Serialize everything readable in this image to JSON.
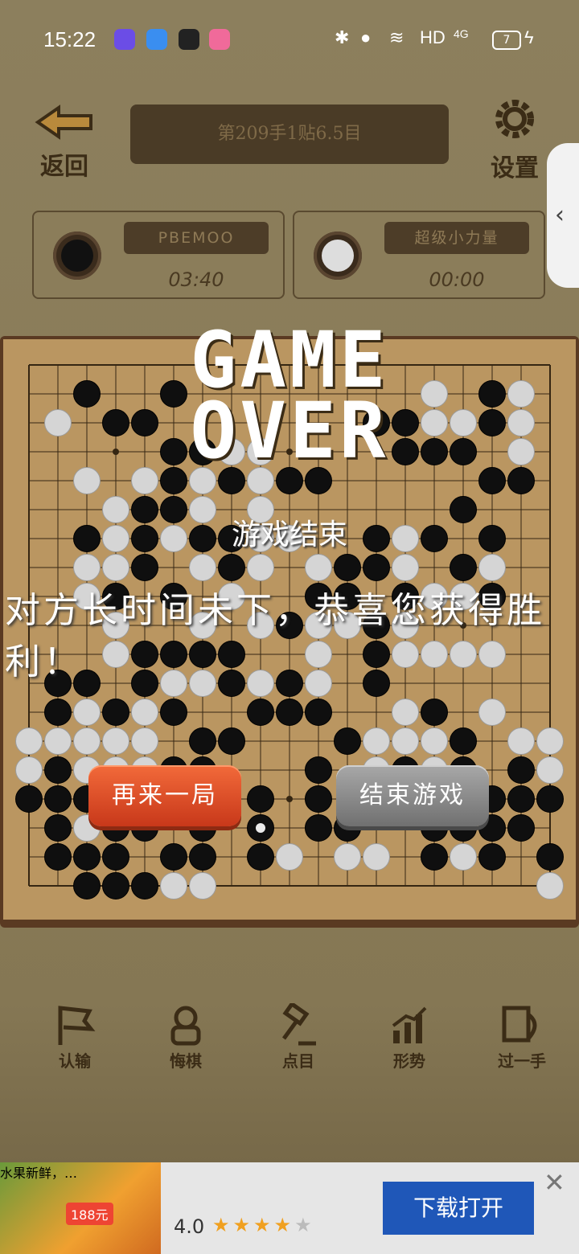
{
  "status_bar": {
    "time": "15:22",
    "network": "HD",
    "signal": "4G",
    "battery": "7"
  },
  "header": {
    "back_label": "返回",
    "settings_label": "设置",
    "move_info": "第209手1贴6.5目"
  },
  "players": [
    {
      "name": "PBEMOO",
      "clock": "03:40",
      "stone": "black"
    },
    {
      "name": "超级小力量",
      "clock": "00:00",
      "stone": "white"
    }
  ],
  "game_over": {
    "title_line1": "GAME",
    "title_line2": "OVER",
    "subtitle": "游戏结束",
    "message": "对方长时间未下，恭喜您获得胜利！",
    "replay_label": "再来一局",
    "end_label": "结束游戏"
  },
  "toolbar": [
    {
      "label": "认输",
      "icon": "flag-icon"
    },
    {
      "label": "悔棋",
      "icon": "undo-hand-icon"
    },
    {
      "label": "点目",
      "icon": "gavel-icon"
    },
    {
      "label": "形势",
      "icon": "chart-icon"
    },
    {
      "label": "过一手",
      "icon": "pass-icon"
    }
  ],
  "ad": {
    "title": "水果新鲜，…",
    "rating": "4.0",
    "cta": "下载打开",
    "badge": "188元"
  },
  "board": {
    "size": 19,
    "last_move": [
      8,
      16
    ],
    "black": [
      [
        2,
        1
      ],
      [
        5,
        1
      ],
      [
        16,
        1
      ],
      [
        3,
        2
      ],
      [
        4,
        2
      ],
      [
        12,
        2
      ],
      [
        13,
        2
      ],
      [
        16,
        2
      ],
      [
        5,
        3
      ],
      [
        6,
        3
      ],
      [
        13,
        3
      ],
      [
        14,
        3
      ],
      [
        15,
        3
      ],
      [
        5,
        4
      ],
      [
        7,
        4
      ],
      [
        9,
        4
      ],
      [
        10,
        4
      ],
      [
        16,
        4
      ],
      [
        17,
        4
      ],
      [
        4,
        5
      ],
      [
        5,
        5
      ],
      [
        15,
        5
      ],
      [
        2,
        6
      ],
      [
        4,
        6
      ],
      [
        6,
        6
      ],
      [
        7,
        6
      ],
      [
        12,
        6
      ],
      [
        14,
        6
      ],
      [
        16,
        6
      ],
      [
        4,
        7
      ],
      [
        7,
        7
      ],
      [
        11,
        7
      ],
      [
        12,
        7
      ],
      [
        15,
        7
      ],
      [
        3,
        8
      ],
      [
        5,
        8
      ],
      [
        10,
        8
      ],
      [
        11,
        8
      ],
      [
        13,
        8
      ],
      [
        16,
        8
      ],
      [
        9,
        9
      ],
      [
        12,
        9
      ],
      [
        4,
        10
      ],
      [
        5,
        10
      ],
      [
        6,
        10
      ],
      [
        7,
        10
      ],
      [
        12,
        10
      ],
      [
        1,
        11
      ],
      [
        2,
        11
      ],
      [
        4,
        11
      ],
      [
        7,
        11
      ],
      [
        9,
        11
      ],
      [
        12,
        11
      ],
      [
        1,
        12
      ],
      [
        3,
        12
      ],
      [
        5,
        12
      ],
      [
        8,
        12
      ],
      [
        9,
        12
      ],
      [
        10,
        12
      ],
      [
        14,
        12
      ],
      [
        6,
        13
      ],
      [
        7,
        13
      ],
      [
        11,
        13
      ],
      [
        15,
        13
      ],
      [
        1,
        14
      ],
      [
        5,
        14
      ],
      [
        6,
        14
      ],
      [
        10,
        14
      ],
      [
        13,
        14
      ],
      [
        15,
        14
      ],
      [
        17,
        14
      ],
      [
        0,
        15
      ],
      [
        1,
        15
      ],
      [
        2,
        15
      ],
      [
        8,
        15
      ],
      [
        10,
        15
      ],
      [
        16,
        15
      ],
      [
        17,
        15
      ],
      [
        18,
        15
      ],
      [
        1,
        16
      ],
      [
        3,
        16
      ],
      [
        4,
        16
      ],
      [
        6,
        16
      ],
      [
        10,
        16
      ],
      [
        11,
        16
      ],
      [
        14,
        16
      ],
      [
        15,
        16
      ],
      [
        16,
        16
      ],
      [
        17,
        16
      ],
      [
        1,
        17
      ],
      [
        2,
        17
      ],
      [
        3,
        17
      ],
      [
        5,
        17
      ],
      [
        6,
        17
      ],
      [
        8,
        17
      ],
      [
        14,
        17
      ],
      [
        16,
        17
      ],
      [
        18,
        17
      ],
      [
        2,
        18
      ],
      [
        3,
        18
      ],
      [
        4,
        18
      ]
    ],
    "white": [
      [
        14,
        1
      ],
      [
        17,
        1
      ],
      [
        1,
        2
      ],
      [
        14,
        2
      ],
      [
        15,
        2
      ],
      [
        17,
        2
      ],
      [
        7,
        3
      ],
      [
        8,
        3
      ],
      [
        17,
        3
      ],
      [
        2,
        4
      ],
      [
        4,
        4
      ],
      [
        6,
        4
      ],
      [
        8,
        4
      ],
      [
        3,
        5
      ],
      [
        6,
        5
      ],
      [
        8,
        5
      ],
      [
        3,
        6
      ],
      [
        5,
        6
      ],
      [
        8,
        6
      ],
      [
        9,
        6
      ],
      [
        13,
        6
      ],
      [
        2,
        7
      ],
      [
        3,
        7
      ],
      [
        6,
        7
      ],
      [
        8,
        7
      ],
      [
        10,
        7
      ],
      [
        13,
        7
      ],
      [
        16,
        7
      ],
      [
        2,
        8
      ],
      [
        7,
        8
      ],
      [
        14,
        8
      ],
      [
        15,
        8
      ],
      [
        3,
        9
      ],
      [
        6,
        9
      ],
      [
        8,
        9
      ],
      [
        10,
        9
      ],
      [
        11,
        9
      ],
      [
        13,
        9
      ],
      [
        3,
        10
      ],
      [
        10,
        10
      ],
      [
        13,
        10
      ],
      [
        14,
        10
      ],
      [
        15,
        10
      ],
      [
        16,
        10
      ],
      [
        5,
        11
      ],
      [
        6,
        11
      ],
      [
        8,
        11
      ],
      [
        10,
        11
      ],
      [
        2,
        12
      ],
      [
        3,
        12
      ],
      [
        4,
        12
      ],
      [
        13,
        12
      ],
      [
        16,
        12
      ],
      [
        0,
        13
      ],
      [
        1,
        13
      ],
      [
        2,
        13
      ],
      [
        3,
        13
      ],
      [
        4,
        13
      ],
      [
        12,
        13
      ],
      [
        13,
        13
      ],
      [
        14,
        13
      ],
      [
        17,
        13
      ],
      [
        18,
        13
      ],
      [
        0,
        14
      ],
      [
        2,
        14
      ],
      [
        3,
        14
      ],
      [
        4,
        14
      ],
      [
        12,
        14
      ],
      [
        14,
        14
      ],
      [
        18,
        14
      ],
      [
        3,
        16
      ],
      [
        4,
        16
      ],
      [
        2,
        16
      ],
      [
        11,
        17
      ],
      [
        12,
        17
      ],
      [
        9,
        17
      ],
      [
        15,
        17
      ],
      [
        5,
        18
      ],
      [
        6,
        18
      ],
      [
        18,
        18
      ]
    ]
  }
}
